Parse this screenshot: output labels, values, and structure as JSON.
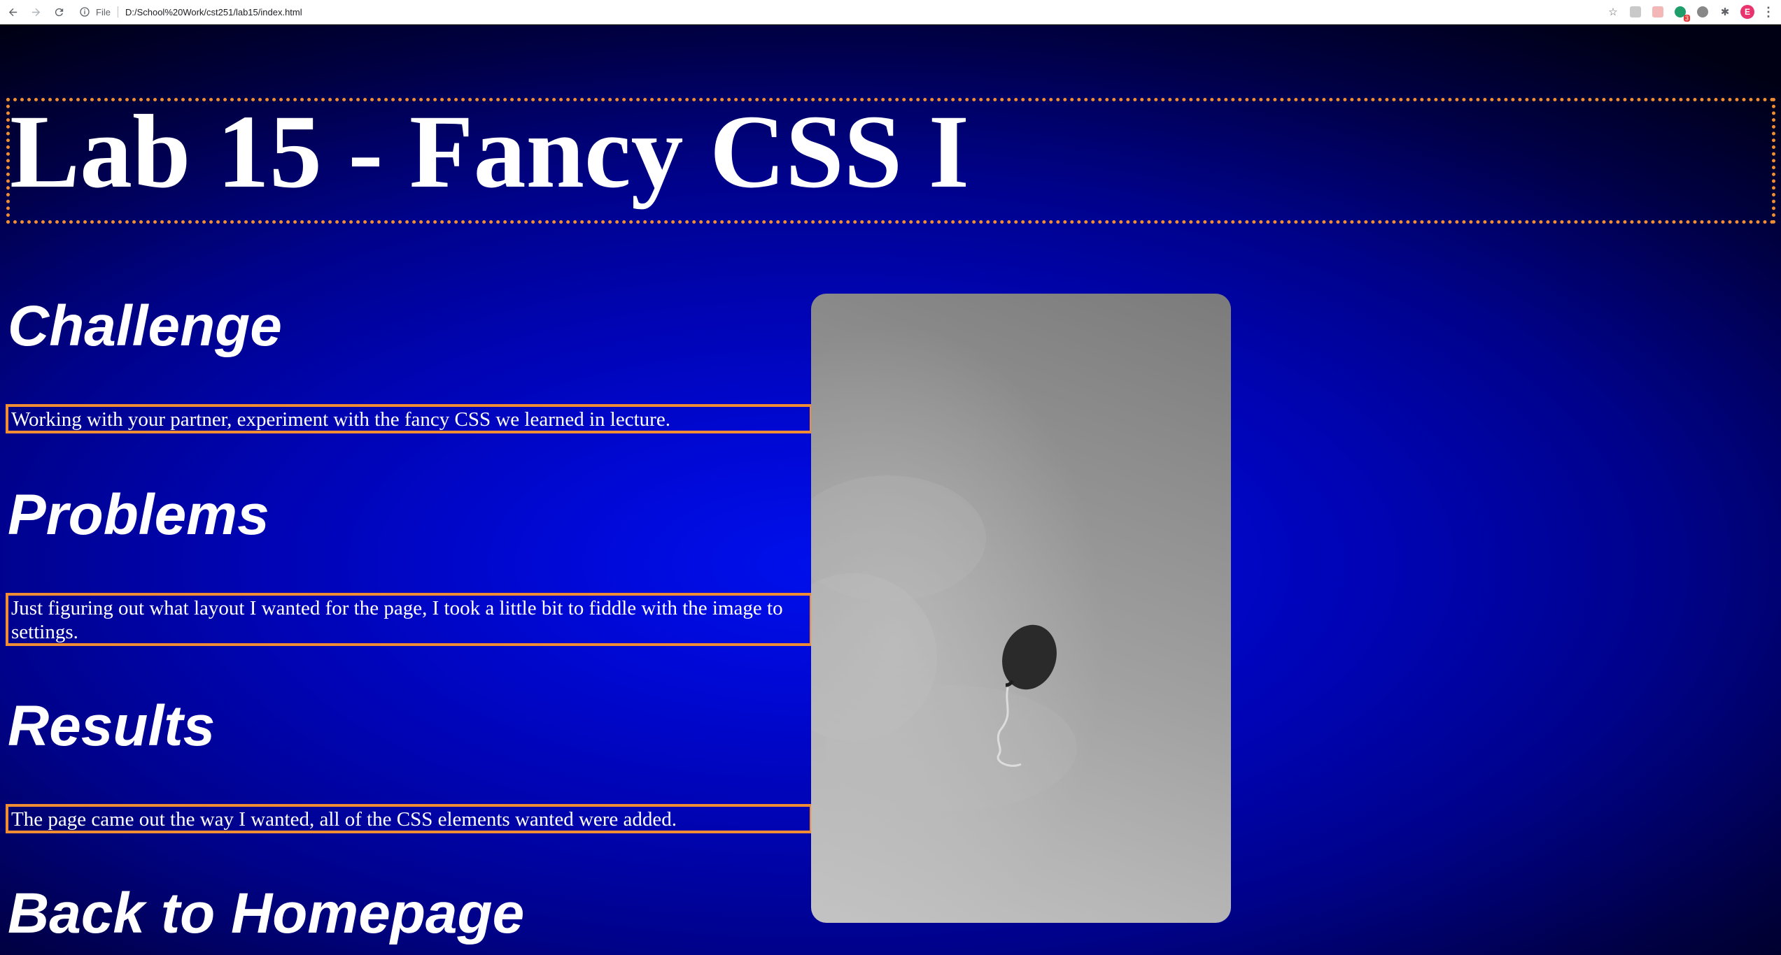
{
  "browser": {
    "file_label": "File",
    "url": "D:/School%20Work/cst251/lab15/index.html",
    "profile_initial": "E",
    "extension_badge": "3",
    "icons": [
      "back-arrow-icon",
      "forward-arrow-icon",
      "reload-icon",
      "info-icon",
      "star-icon",
      "puzzle-icon",
      "menu-dots-icon"
    ]
  },
  "page": {
    "title": "Lab 15 - Fancy CSS I",
    "sections": [
      {
        "heading": "Challenge",
        "text": "Working with your partner, experiment with the fancy CSS we learned in lecture."
      },
      {
        "heading": "Problems",
        "text": "Just figuring out what layout I wanted for the page, I took a little bit to fiddle with the image to settings."
      },
      {
        "heading": "Results",
        "text": "The page came out the way I wanted, all of the CSS elements wanted were added."
      }
    ],
    "back_link": "Back to Homepage",
    "image": {
      "subject": "grayscale photo of a single balloon against the sky"
    }
  },
  "colors": {
    "accent_border": "#f08c33",
    "background_center": "#0010ec",
    "background_edge": "#000014",
    "text": "#ffffff"
  }
}
